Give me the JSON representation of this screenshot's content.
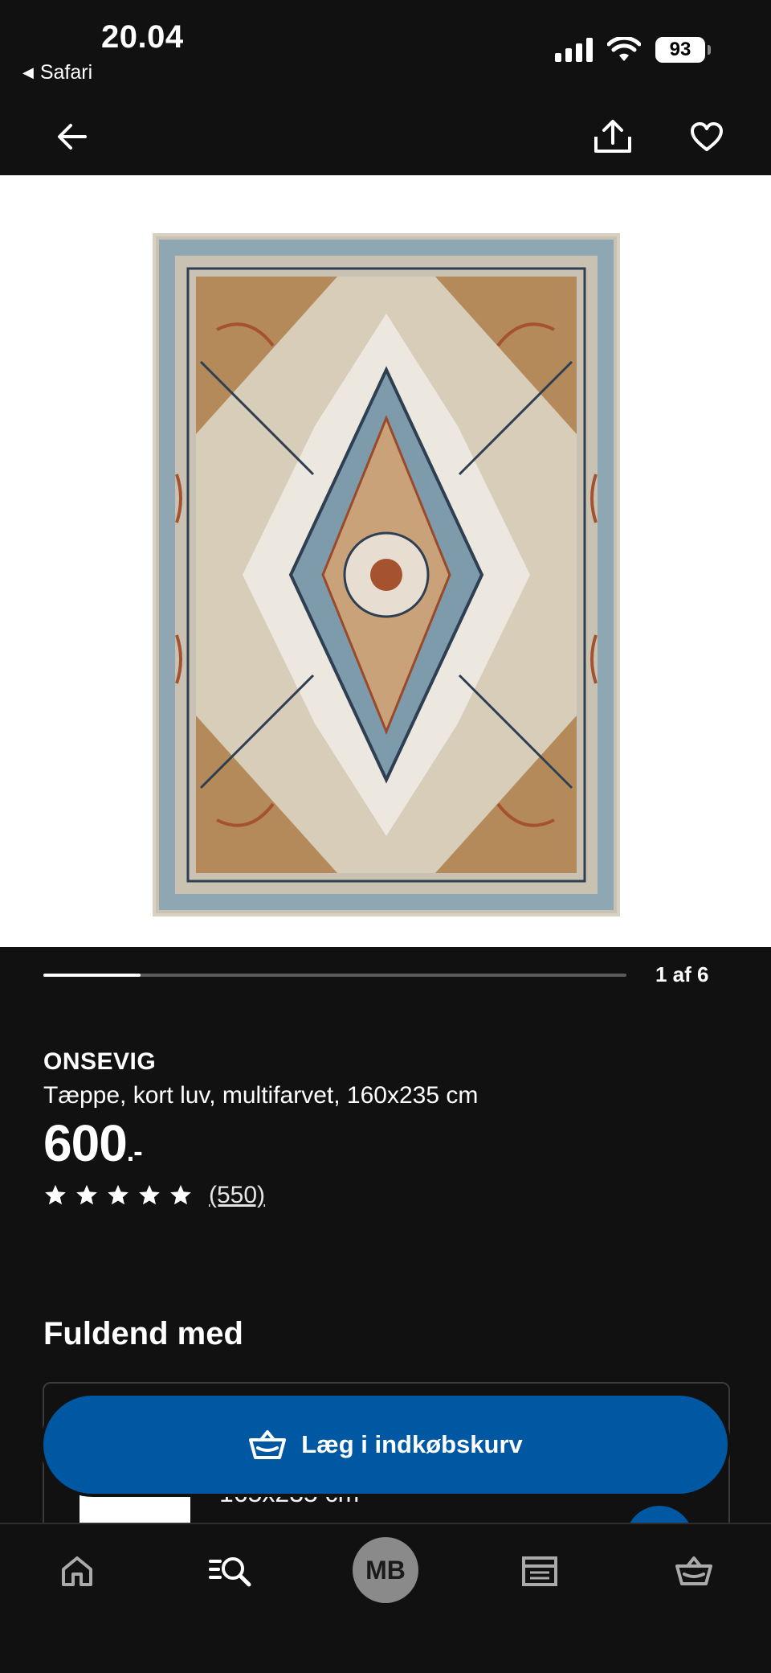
{
  "status_bar": {
    "time": "20.04",
    "back_app": "Safari",
    "battery": "93"
  },
  "header": {
    "back_icon": "arrow-left-icon",
    "share_icon": "share-icon",
    "favorite_icon": "heart-icon"
  },
  "gallery": {
    "current_label": "1 af 6",
    "progress_fraction": 0.1667
  },
  "product": {
    "name": "ONSEVIG",
    "description": "Tæppe, kort luv, multifarvet, 160x235 cm",
    "price": "600",
    "price_suffix": ".-",
    "rating_stars": 5,
    "review_count": "(550)"
  },
  "complement": {
    "heading": "Fuldend med",
    "item_text": "165x235 cm"
  },
  "cart_button": {
    "label": "Læg i indkøbskurv",
    "color": "#0058a3"
  },
  "bottom_nav": {
    "items": [
      "home-icon",
      "search-icon",
      "profile-avatar",
      "store-icon",
      "basket-icon"
    ],
    "avatar_initials": "MB"
  }
}
